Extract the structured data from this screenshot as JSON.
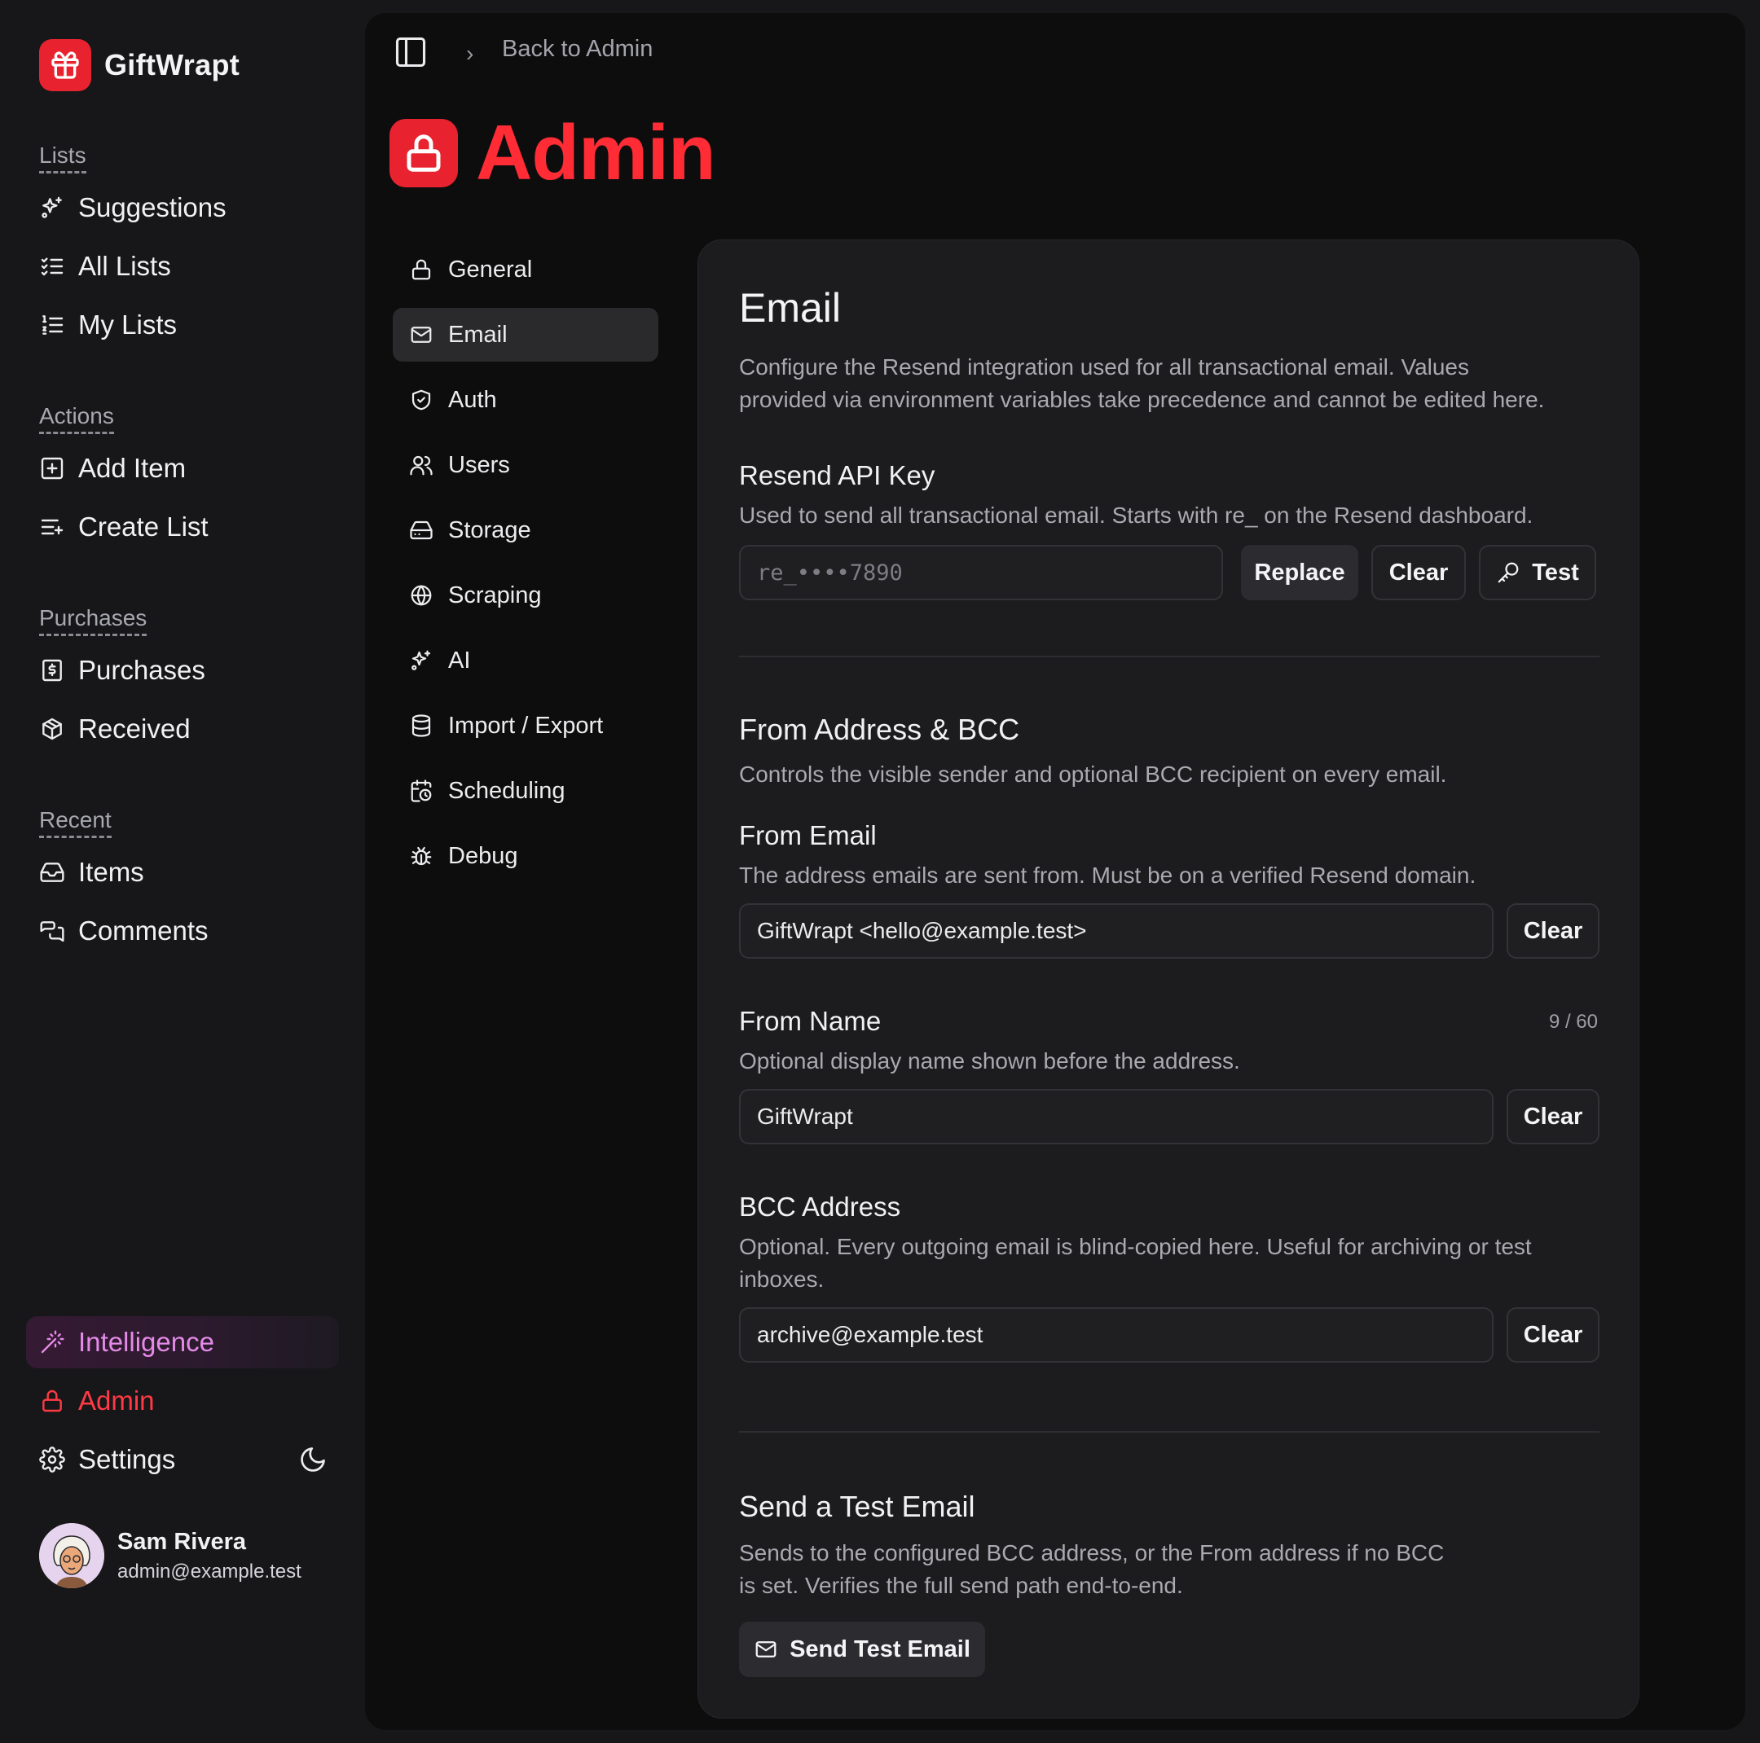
{
  "app": {
    "name": "GiftWrapt"
  },
  "sidebar": {
    "sections": [
      {
        "heading": "Lists",
        "items": [
          "Suggestions",
          "All Lists",
          "My Lists"
        ]
      },
      {
        "heading": "Actions",
        "items": [
          "Add Item",
          "Create List"
        ]
      },
      {
        "heading": "Purchases",
        "items": [
          "Purchases",
          "Received"
        ]
      },
      {
        "heading": "Recent",
        "items": [
          "Items",
          "Comments"
        ]
      }
    ],
    "bottom": {
      "intelligence": "Intelligence",
      "admin": "Admin",
      "settings": "Settings"
    },
    "user": {
      "name": "Sam Rivera",
      "email": "admin@example.test"
    }
  },
  "colors": {
    "accent_red": "#e8232f",
    "title_red": "#ff2b35",
    "intelligence_pink": "#e48ae8"
  },
  "header": {
    "breadcrumb": "Back to Admin",
    "title": "Admin"
  },
  "subnav": {
    "items": [
      "General",
      "Email",
      "Auth",
      "Users",
      "Storage",
      "Scraping",
      "AI",
      "Import / Export",
      "Scheduling",
      "Debug"
    ],
    "active": "Email"
  },
  "email": {
    "title": "Email",
    "description_line1": "Configure the Resend integration used for all transactional email. Values",
    "description_line2": "provided via environment variables take precedence and cannot be edited here.",
    "api_key": {
      "label": "Resend API Key",
      "help": "Used to send all transactional email. Starts with re_ on the Resend dashboard.",
      "value": "re_••••7890",
      "replace": "Replace",
      "clear": "Clear",
      "test": "Test"
    },
    "from_section": {
      "title": "From Address & BCC",
      "description": "Controls the visible sender and optional BCC recipient on every email."
    },
    "from_email": {
      "label": "From Email",
      "help": "The address emails are sent from. Must be on a verified Resend domain.",
      "value": "GiftWrapt <hello@example.test>",
      "clear": "Clear"
    },
    "from_name": {
      "label": "From Name",
      "counter": "9 / 60",
      "help": "Optional display name shown before the address.",
      "value": "GiftWrapt",
      "clear": "Clear"
    },
    "bcc": {
      "label": "BCC Address",
      "help_line1": "Optional. Every outgoing email is blind-copied here. Useful for archiving or test",
      "help_line2": "inboxes.",
      "value": "archive@example.test",
      "clear": "Clear"
    },
    "test_email": {
      "title": "Send a Test Email",
      "description_line1": "Sends to the configured BCC address, or the From address if no BCC",
      "description_line2": "is set. Verifies the full send path end-to-end.",
      "button": "Send Test Email"
    }
  }
}
